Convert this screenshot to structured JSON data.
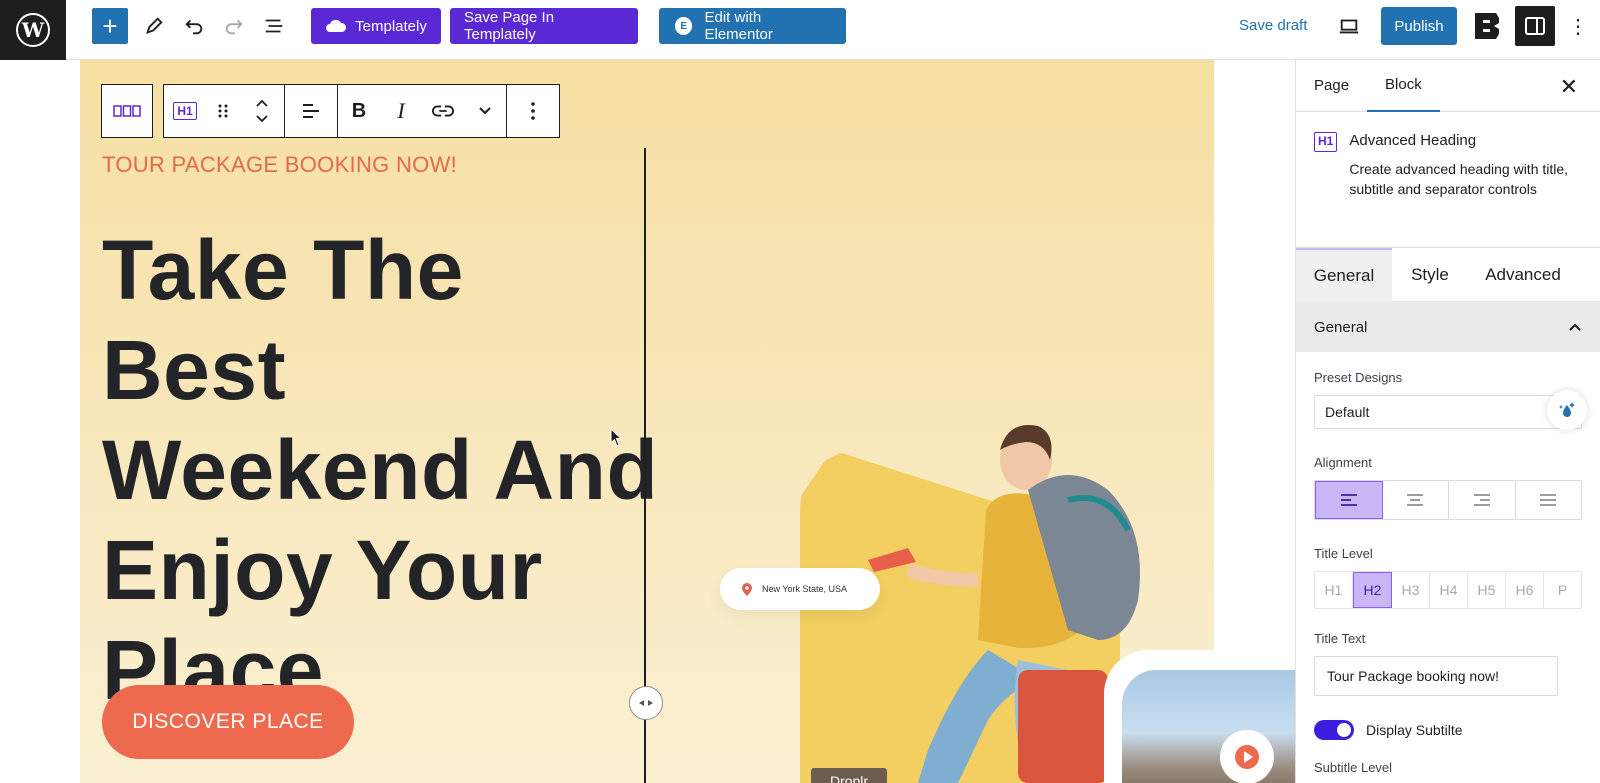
{
  "topbar": {
    "templately_label": "Templately",
    "save_templately_label": "Save Page In Templately",
    "edit_elementor_label": "Edit with Elementor",
    "elementor_badge": "E",
    "save_draft_label": "Save draft",
    "publish_label": "Publish",
    "add_label": "+",
    "more_label": "⋮",
    "wp_logo_letter": "W"
  },
  "block_toolbar": {
    "heading_chip": "H1",
    "bold": "B",
    "italic": "I"
  },
  "hero": {
    "subtitle": "TOUR PACKAGE BOOKING NOW!",
    "title_lines": [
      "Take The Best",
      "Weekend And",
      "Enjoy Your",
      "Place"
    ],
    "cta_label": "DISCOVER PLACE",
    "location": "New York State, USA",
    "droplr": "Droplr"
  },
  "sidebar": {
    "tabs": [
      "Page",
      "Block"
    ],
    "active_tab": "Block",
    "close_label": "✕",
    "block": {
      "icon_label": "H1",
      "title": "Advanced Heading",
      "description": "Create advanced heading with title, subtitle and separator controls"
    },
    "settings_tabs": [
      "General",
      "Style",
      "Advanced"
    ],
    "section_title": "General",
    "preset_label": "Preset Designs",
    "preset_value": "Default",
    "alignment_label": "Alignment",
    "title_level_label": "Title Level",
    "title_levels": [
      "H1",
      "H2",
      "H3",
      "H4",
      "H5",
      "H6",
      "P"
    ],
    "active_level": "H2",
    "title_text_label": "Title Text",
    "title_text_value": "Tour Package booking now!",
    "display_subtitle_label": "Display Subtilte",
    "subtitle_level_label": "Subtitle Level"
  },
  "colors": {
    "wp_blue": "#2271b1",
    "templately_purple": "#5b28d6",
    "accent_red": "#ee6a4f",
    "hero_bg": "#f6dfa2",
    "selected_level": "#c9b6f5"
  }
}
